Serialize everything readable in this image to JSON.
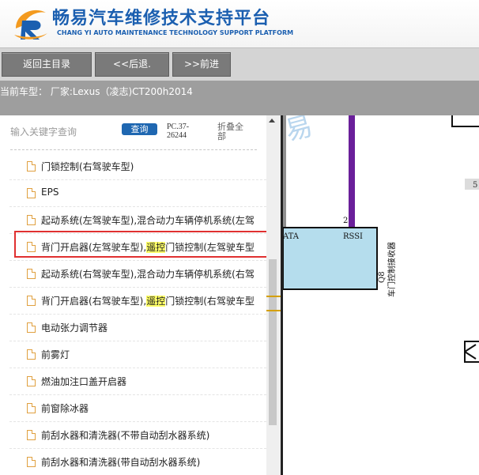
{
  "header": {
    "title": "畅易汽车维修技术支持平台",
    "subtitle": "CHANG YI AUTO MAINTENANCE TECHNOLOGY SUPPORT PLATFORM",
    "logo_icon": "cy-logo-icon"
  },
  "nav": {
    "home_label": "返回主目录",
    "back_label": "<<后退.",
    "forward_label": ">>前进"
  },
  "car": {
    "info": "当前车型：  厂家:Lexus（凌志)CT200h2014"
  },
  "search": {
    "placeholder": "输入关键字查询",
    "button_label": "查询",
    "pc_code": "PC.37-26244",
    "collapse_label": "折叠全部"
  },
  "list": [
    {
      "label": "门锁控制(右驾驶车型)"
    },
    {
      "label": "EPS"
    },
    {
      "label": "起动系统(左驾驶车型),混合动力车辆停机系统(左驾"
    },
    {
      "pre": "背门开启器(左驾驶车型),",
      "hl": "遥控",
      "post": "门锁控制(左驾驶车型",
      "selected": true
    },
    {
      "label": "起动系统(右驾驶车型),混合动力车辆停机系统(右驾"
    },
    {
      "pre": "背门开启器(右驾驶车型),",
      "hl": "遥控",
      "post": "门锁控制(右驾驶车型"
    },
    {
      "label": "电动张力调节器"
    },
    {
      "label": "前雾灯"
    },
    {
      "label": "燃油加注口盖开启器"
    },
    {
      "label": "前窗除冰器"
    },
    {
      "label": "前刮水器和清洗器(不带自动刮水器系统)"
    },
    {
      "label": "前刮水器和清洗器(带自动刮水器系统)"
    }
  ],
  "diagram": {
    "pin_2": "2",
    "pin_ata": "ATA",
    "pin_rssi": "RSSI",
    "component_id": "Q8",
    "component_name": "车门控制接收器",
    "label_5": "5",
    "watermark": "易"
  }
}
